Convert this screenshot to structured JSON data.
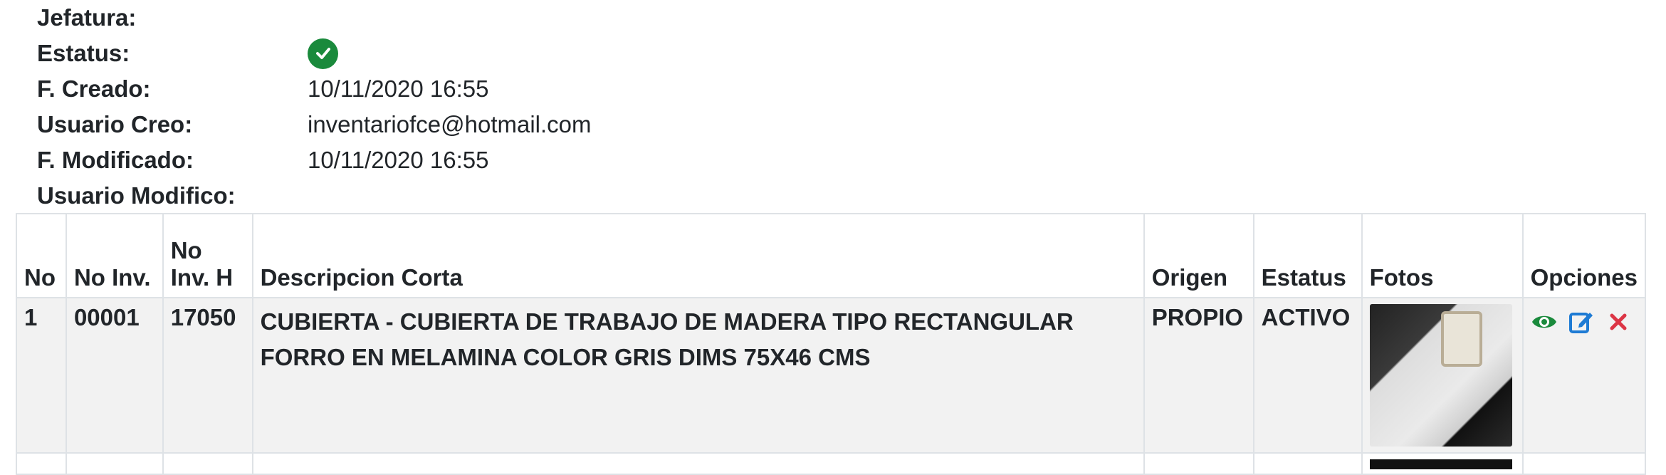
{
  "info": [
    {
      "label": "Jefatura:",
      "value": ""
    },
    {
      "label": "Estatus:",
      "value": ""
    },
    {
      "label": "F. Creado:",
      "value": "10/11/2020 16:55"
    },
    {
      "label": "Usuario Creo:",
      "value": "inventariofce@hotmail.com"
    },
    {
      "label": "F. Modificado:",
      "value": "10/11/2020 16:55"
    },
    {
      "label": "Usuario Modifico:",
      "value": ""
    }
  ],
  "status_icon": "check-circle-icon",
  "colors": {
    "check": "#1a8a3c",
    "view": "#1a8a3c",
    "edit": "#1e7bd4",
    "delete": "#dc3545"
  },
  "table": {
    "headers": {
      "no": "No",
      "no_inv": "No Inv.",
      "no_inv_h_1": "No",
      "no_inv_h_2": "Inv. H",
      "descripcion": "Descripcion Corta",
      "origen": "Origen",
      "estatus": "Estatus",
      "fotos": "Fotos",
      "opciones": "Opciones"
    },
    "rows": [
      {
        "no": "1",
        "no_inv": "00001",
        "no_inv_h": "17050",
        "descripcion_1": "CUBIERTA - CUBIERTA DE TRABAJO DE MADERA TIPO RECTANGULAR",
        "descripcion_2": "FORRO EN MELAMINA COLOR GRIS DIMS 75X46 CMS",
        "origen": "PROPIO",
        "estatus": "ACTIVO",
        "photo": "desk-photo",
        "options": [
          "eye-icon",
          "edit-icon",
          "close-icon"
        ]
      }
    ]
  }
}
